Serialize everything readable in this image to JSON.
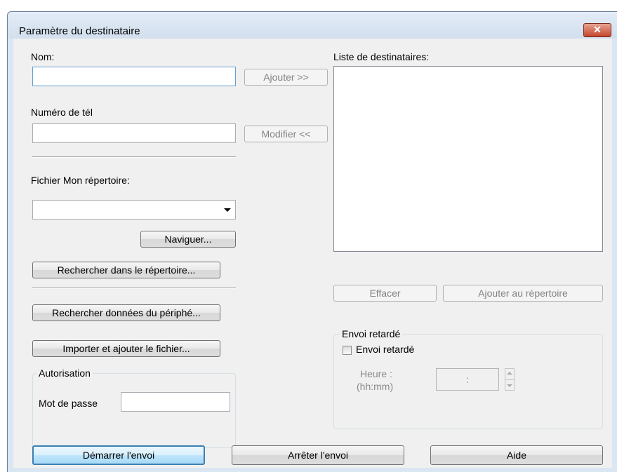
{
  "window": {
    "title": "Paramètre du destinataire",
    "close_label": "✕"
  },
  "fields": {
    "name_label": "Nom:",
    "phone_label": "Numéro de tél",
    "phonebook_label": "Fichier Mon répertoire:",
    "recipients_label": "Liste de destinataires:"
  },
  "buttons": {
    "add": "Ajouter >>",
    "modify": "Modifier <<",
    "browse": "Naviguer...",
    "search_phonebook": "Rechercher dans le répertoire...",
    "search_device": "Rechercher données du périphé...",
    "import_file": "Importer et ajouter le fichier...",
    "clear": "Effacer",
    "add_to_phonebook": "Ajouter au répertoire",
    "start_send": "Démarrer l'envoi",
    "stop_send": "Arrêter l'envoi",
    "help": "Aide"
  },
  "auth": {
    "group_title": "Autorisation",
    "password_label": "Mot de passe"
  },
  "delayed": {
    "group_title": "Envoi retardé",
    "checkbox_label": "Envoi retardé",
    "time_label_1": "Heure :",
    "time_label_2": "(hh:mm)",
    "time_separator": ":"
  }
}
